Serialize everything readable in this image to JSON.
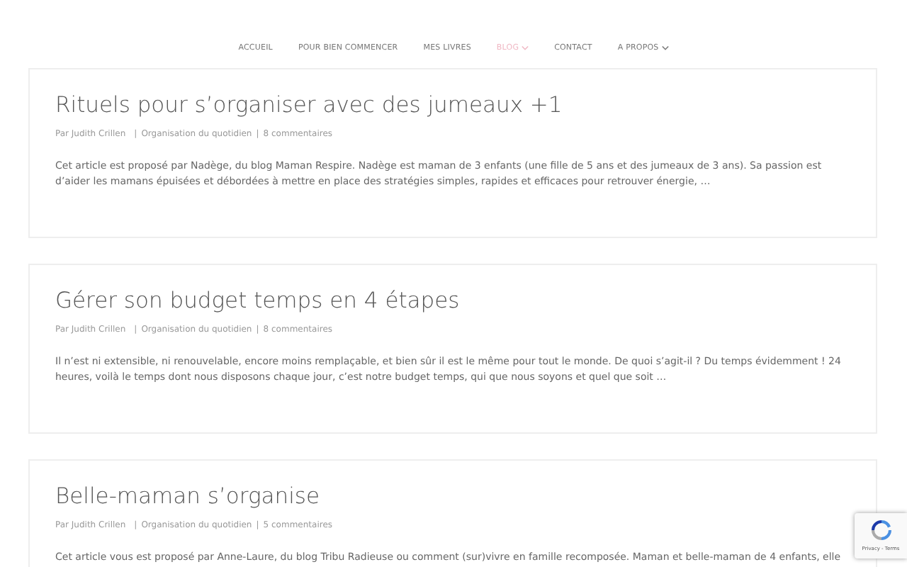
{
  "nav": [
    {
      "label": "ACCUEIL",
      "selected": false,
      "dropdown": false
    },
    {
      "label": "POUR BIEN COMMENCER",
      "selected": false,
      "dropdown": false
    },
    {
      "label": "MES LIVRES",
      "selected": false,
      "dropdown": false
    },
    {
      "label": "BLOG",
      "selected": true,
      "dropdown": true
    },
    {
      "label": "CONTACT",
      "selected": false,
      "dropdown": false
    },
    {
      "label": "A PROPOS",
      "selected": false,
      "dropdown": true
    }
  ],
  "meta_separator": "|",
  "posts": [
    {
      "title": "Rituels pour s’organiser avec des jumeaux +1",
      "author": "Par Judith Crillen",
      "category": "Organisation du quotidien",
      "comments": "8 commentaires",
      "excerpt": "Cet article est proposé par Nadège, du blog Maman Respire. Nadège est maman de 3 enfants (une fille de 5 ans et des jumeaux de 3 ans). Sa passion est d’aider les mamans épuisées et débordées à mettre en place des stratégies simples, rapides et efficaces pour retrouver énergie, …"
    },
    {
      "title": "Gérer son budget temps en 4 étapes",
      "author": "Par Judith Crillen",
      "category": "Organisation du quotidien",
      "comments": "8 commentaires",
      "excerpt": "Il n’est ni extensible, ni renouvelable, encore moins remplaçable, et bien sûr il est le même pour tout le monde. De quoi s’agit-il ? Du temps évidemment ! 24 heures, voilà le temps dont nous disposons chaque jour, c’est notre budget temps, qui que nous soyons et quel que soit …"
    },
    {
      "title": "Belle-maman s’organise",
      "author": "Par Judith Crillen",
      "category": "Organisation du quotidien",
      "comments": "5 commentaires",
      "excerpt": "Cet article vous est proposé par Anne-Laure, du blog Tribu Radieuse ou comment (sur)vivre en famille recomposée. Maman et belle-maman de 4 enfants, elle"
    }
  ],
  "recaptcha": {
    "links": "Privacy - Terms"
  }
}
